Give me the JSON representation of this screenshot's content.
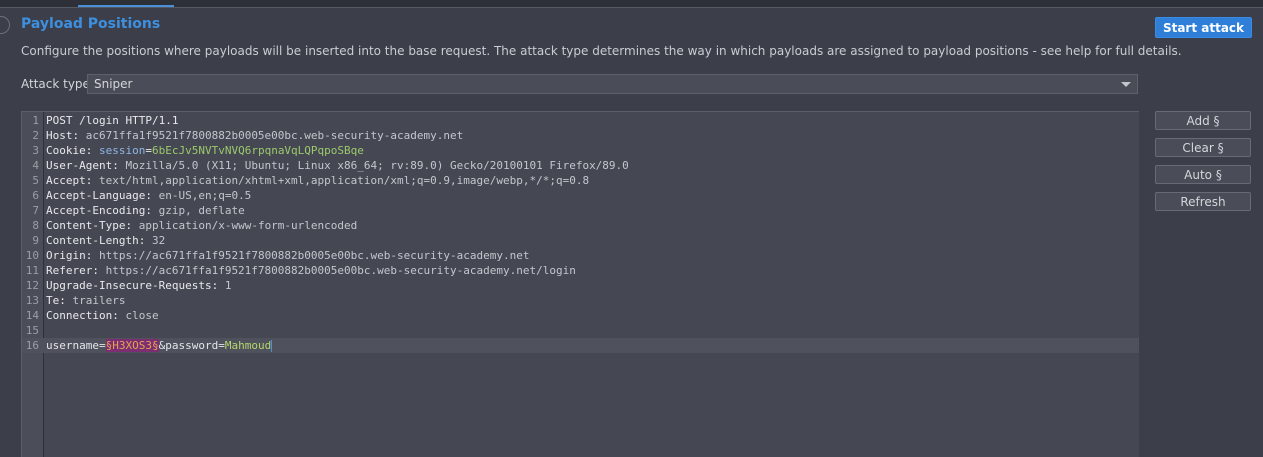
{
  "panel": {
    "title": "Payload Positions",
    "description": "Configure the positions where payloads will be inserted into the base request. The attack type determines the way in which payloads are assigned to payload positions - see help for full details.",
    "start_attack_label": "Start attack"
  },
  "attack_type": {
    "label": "Attack type:",
    "selected": "Sniper"
  },
  "side_buttons": {
    "add": "Add §",
    "clear": "Clear §",
    "auto": "Auto §",
    "refresh": "Refresh"
  },
  "request": {
    "line1": "POST /login HTTP/1.1",
    "headers": [
      {
        "n": "2",
        "key": "Host",
        "value": "ac671ffa1f9521f7800882b0005e00bc.web-security-academy.net"
      },
      {
        "n": "3",
        "key": "Cookie",
        "cookie_name": "session",
        "cookie_value": "6bEcJv5NVTvNVQ6rpqnaVqLQPqpoSBqe"
      },
      {
        "n": "4",
        "key": "User-Agent",
        "value": "Mozilla/5.0 (X11; Ubuntu; Linux x86_64; rv:89.0) Gecko/20100101 Firefox/89.0"
      },
      {
        "n": "5",
        "key": "Accept",
        "value": "text/html,application/xhtml+xml,application/xml;q=0.9,image/webp,*/*;q=0.8"
      },
      {
        "n": "6",
        "key": "Accept-Language",
        "value": "en-US,en;q=0.5"
      },
      {
        "n": "7",
        "key": "Accept-Encoding",
        "value": "gzip, deflate"
      },
      {
        "n": "8",
        "key": "Content-Type",
        "value": "application/x-www-form-urlencoded"
      },
      {
        "n": "9",
        "key": "Content-Length",
        "value": "32"
      },
      {
        "n": "10",
        "key": "Origin",
        "value": "https://ac671ffa1f9521f7800882b0005e00bc.web-security-academy.net"
      },
      {
        "n": "11",
        "key": "Referer",
        "value": "https://ac671ffa1f9521f7800882b0005e00bc.web-security-academy.net/login"
      },
      {
        "n": "12",
        "key": "Upgrade-Insecure-Requests",
        "value": "1"
      },
      {
        "n": "13",
        "key": "Te",
        "value": "trailers"
      },
      {
        "n": "14",
        "key": "Connection",
        "value": "close"
      }
    ],
    "body": {
      "username_key": "username",
      "username_value": "§H3XOS3§",
      "sep": "&",
      "password_key": "password",
      "password_value": "Mahmoud"
    }
  },
  "colors": {
    "accent": "#2f7fd9",
    "title": "#3d8fe0",
    "payload_marker_bg": "#7b2f72",
    "payload_marker_fg": "#e5a34d"
  }
}
